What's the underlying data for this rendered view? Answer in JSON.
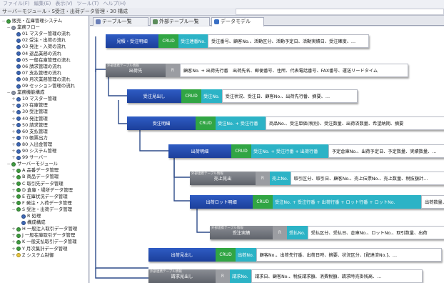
{
  "menubar": {
    "items": [
      "ファイル(F)",
      "編集(E)",
      "表示(V)",
      "ツール(T)",
      "ヘルプ(H)"
    ]
  },
  "window": {
    "title": "サーバーモジュール・S受注・出荷データ管理・30 構成"
  },
  "tabs": [
    {
      "label": "テーブル一覧",
      "active": false,
      "icon": "table-icon"
    },
    {
      "label": "外部テーブル一覧",
      "active": false,
      "icon": "external-table-icon"
    },
    {
      "label": "データモデル",
      "active": true,
      "icon": "data-model-icon"
    }
  ],
  "tree": {
    "items": [
      {
        "label": "販売・在庫管理システム",
        "level": 0,
        "icon": "green",
        "exp": "−"
      },
      {
        "label": "業務フロー",
        "level": 1,
        "icon": "gray",
        "exp": "−"
      },
      {
        "label": "01 マスター管理の流れ",
        "level": 2,
        "icon": "blue",
        "exp": ""
      },
      {
        "label": "02 受注・出荷の流れ",
        "level": 2,
        "icon": "blue",
        "exp": ""
      },
      {
        "label": "03 発注・入荷の流れ",
        "level": 2,
        "icon": "blue",
        "exp": ""
      },
      {
        "label": "04 返品業務の流れ",
        "level": 2,
        "icon": "blue",
        "exp": ""
      },
      {
        "label": "05 一般在庫管理の流れ",
        "level": 2,
        "icon": "blue",
        "exp": ""
      },
      {
        "label": "06 請求管理の流れ",
        "level": 2,
        "icon": "blue",
        "exp": ""
      },
      {
        "label": "07 支払管理の流れ",
        "level": 2,
        "icon": "blue",
        "exp": ""
      },
      {
        "label": "08 月次業務管理の流れ",
        "level": 2,
        "icon": "blue",
        "exp": ""
      },
      {
        "label": "09 セッション管理の流れ",
        "level": 2,
        "icon": "blue",
        "exp": ""
      },
      {
        "label": "業務機能構成",
        "level": 1,
        "icon": "gray",
        "exp": "−"
      },
      {
        "label": "10 マスター管理",
        "level": 2,
        "icon": "blue",
        "exp": "+"
      },
      {
        "label": "20 在庫管理",
        "level": 2,
        "icon": "blue",
        "exp": "+"
      },
      {
        "label": "30 受注管理",
        "level": 2,
        "icon": "blue",
        "exp": "+"
      },
      {
        "label": "40 発注管理",
        "level": 2,
        "icon": "blue",
        "exp": "+"
      },
      {
        "label": "50 請求管理",
        "level": 2,
        "icon": "blue",
        "exp": "+"
      },
      {
        "label": "60 支払管理",
        "level": 2,
        "icon": "blue",
        "exp": "+"
      },
      {
        "label": "70 帳票出力",
        "level": 2,
        "icon": "blue",
        "exp": "+"
      },
      {
        "label": "80 入出金管理",
        "level": 2,
        "icon": "blue",
        "exp": "+"
      },
      {
        "label": "90 システム管理",
        "level": 2,
        "icon": "blue",
        "exp": "+"
      },
      {
        "label": "99 サーバー",
        "level": 2,
        "icon": "blue",
        "exp": "+"
      },
      {
        "label": "サーバーモジュール",
        "level": 1,
        "icon": "green",
        "exp": "−"
      },
      {
        "label": "A 品番データ管理",
        "level": 2,
        "icon": "green",
        "exp": "+"
      },
      {
        "label": "B 商品データ管理",
        "level": 2,
        "icon": "green",
        "exp": "+"
      },
      {
        "label": "C 取引先データ管理",
        "level": 2,
        "icon": "green",
        "exp": "+"
      },
      {
        "label": "D 倉庫・場所データ管理",
        "level": 2,
        "icon": "green",
        "exp": "+"
      },
      {
        "label": "E 在庫状況データ管理",
        "level": 2,
        "icon": "green",
        "exp": "+"
      },
      {
        "label": "F 発注・入荷データ管理",
        "level": 2,
        "icon": "green",
        "exp": "+"
      },
      {
        "label": "S 受注・出荷データ管理",
        "level": 2,
        "icon": "green",
        "exp": "−"
      },
      {
        "label": "R 処理",
        "level": 3,
        "icon": "blue",
        "exp": ""
      },
      {
        "label": "構成構成",
        "level": 3,
        "icon": "blue",
        "exp": ""
      },
      {
        "label": "H 一般注入取引データ管理",
        "level": 2,
        "icon": "green",
        "exp": "+"
      },
      {
        "label": "J 一般在庫取引データ管理",
        "level": 2,
        "icon": "green",
        "exp": "+"
      },
      {
        "label": "K 一般支払取引データ管理",
        "level": 2,
        "icon": "green",
        "exp": "+"
      },
      {
        "label": "Y 月次集計データ管理",
        "level": 2,
        "icon": "green",
        "exp": "+"
      },
      {
        "label": "Z システム制御",
        "level": 2,
        "icon": "yellow",
        "exp": "+"
      }
    ]
  },
  "entities": [
    {
      "name": "見積・受注明細",
      "sub": "",
      "style": "blue",
      "crud": "CRUD",
      "crud_style": "green",
      "key": "受注連番No.",
      "attrs": "受注番号、顧客No.、活動区分、活動予定日、活動実績日、受注確度、…"
    },
    {
      "name": "出荷先",
      "sub": "外部連携テーブル情報",
      "style": "gray",
      "crud": "R",
      "crud_style": "gray",
      "key": "",
      "attrs": "顧客No. + 出荷先行番　出荷先名、郵便番号、住所、代表電話番号、FAX番号、運送リードタイム"
    },
    {
      "name": "受注見出し",
      "sub": "",
      "style": "blue",
      "crud": "CRUD",
      "crud_style": "green",
      "key": "受注No.",
      "attrs": "受注状況、受注日、顧客No.、出荷先行番、摘要、…"
    },
    {
      "name": "受注明細",
      "sub": "",
      "style": "blue",
      "crud": "CRUD",
      "crud_style": "green",
      "key": "受注No. + 受注行番",
      "attrs": "商品No.、受注単価(税別)、受注数量、出荷済数量、希望納期、摘要"
    },
    {
      "name": "出荷明細",
      "sub": "",
      "style": "blue",
      "crud": "CRUD",
      "crud_style": "green",
      "key": "受注No. + 受注行番 + 出荷行番",
      "attrs": "予定倉庫No.、出荷予定日、予定数量、実績数量、…"
    },
    {
      "name": "売上見出",
      "sub": "外部連携テーブル情報",
      "style": "gray",
      "crud": "R",
      "crud_style": "gray",
      "key": "売上No.",
      "attrs": "取引区分、取引日、顧客No.、売上伝票No.、売上数量、税抜額計…"
    },
    {
      "name": "出荷ロット明細",
      "sub": "",
      "style": "blue",
      "crud": "CRUD",
      "crud_style": "green",
      "key": "受注No. + 受注行番 + 出荷行番 + ロット行番 + ロットNo.",
      "attrs": "出荷数量、(ホ"
    },
    {
      "name": "受注実績",
      "sub": "外部連携テーブル情報",
      "style": "gray",
      "crud": "R",
      "crud_style": "gray",
      "key": "受払No.",
      "attrs": "受払区分、受払日、倉庫No.、ロットNo.、取引数量、出荷"
    },
    {
      "name": "出荷見出し",
      "sub": "",
      "style": "blue",
      "crud": "CRUD",
      "crud_style": "green",
      "key": "出荷No.",
      "attrs": "顧客No.、出荷先行番、出荷日時、摘要、状況区分、[配達済No.]、…"
    },
    {
      "name": "請求見出し",
      "sub": "外部連携テーブル情報",
      "style": "gray",
      "crud": "R",
      "crud_style": "gray",
      "key": "請求No.",
      "attrs": "請求日、顧客No.、税抜請求額、消費税額、請求時売掛残高、…"
    }
  ]
}
